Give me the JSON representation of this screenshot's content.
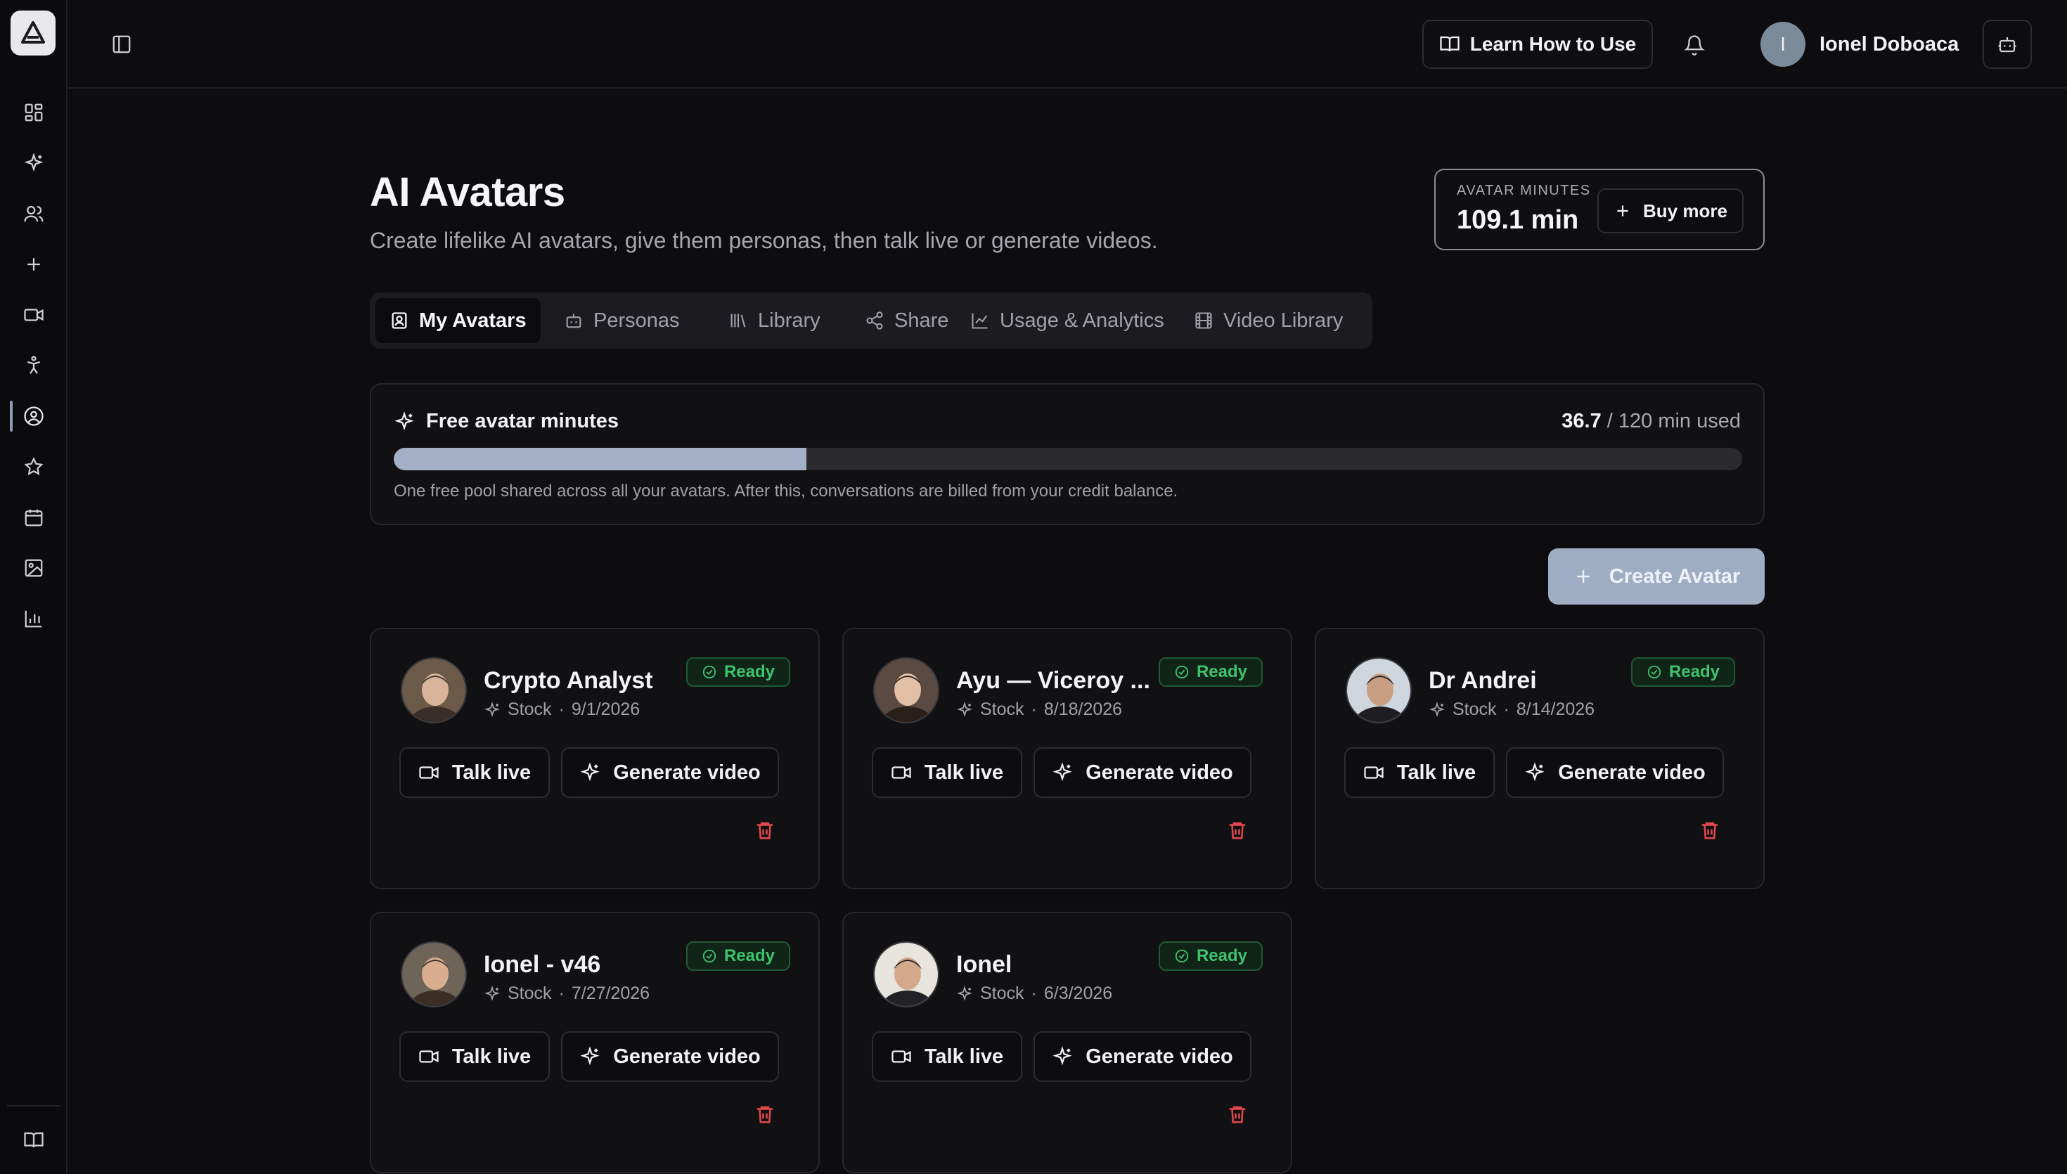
{
  "app": {
    "user_initial": "I",
    "user_name": "Ionel Doboaca",
    "learn_label": "Learn How to Use"
  },
  "header": {
    "title": "AI Avatars",
    "subtitle": "Create lifelike AI avatars, give them personas, then talk live or generate videos.",
    "minutes_label": "AVATAR MINUTES",
    "minutes_value": "109.1 min",
    "buy_label": "Buy more"
  },
  "tabs": [
    {
      "label": "My Avatars",
      "icon": "contact-icon",
      "active": true
    },
    {
      "label": "Personas",
      "icon": "bot-icon"
    },
    {
      "label": "Library",
      "icon": "library-icon"
    },
    {
      "label": "Share",
      "icon": "share-icon"
    },
    {
      "label": "Usage & Analytics",
      "icon": "chart-line-icon"
    },
    {
      "label": "Video Library",
      "icon": "film-icon"
    }
  ],
  "free_minutes": {
    "title": "Free avatar minutes",
    "used": "36.7",
    "total_text": "/ 120 min used",
    "used_fraction": 0.306,
    "note": "One free pool shared across all your avatars. After this, conversations are billed from your credit balance."
  },
  "create_label": "Create Avatar",
  "card_labels": {
    "ready": "Ready",
    "talk": "Talk live",
    "generate": "Generate video",
    "sep": "·"
  },
  "avatars": [
    {
      "name": "Crypto Analyst",
      "source": "Stock",
      "date": "9/1/2026"
    },
    {
      "name": "Ayu — Viceroy ...",
      "source": "Stock",
      "date": "8/18/2026"
    },
    {
      "name": "Dr Andrei",
      "source": "Stock",
      "date": "8/14/2026"
    },
    {
      "name": "Ionel - v46",
      "source": "Stock",
      "date": "7/27/2026"
    },
    {
      "name": "Ionel",
      "source": "Stock",
      "date": "6/3/2026"
    }
  ],
  "colors": {
    "accent": "#9fadc4",
    "ready": "#3fc16e",
    "danger": "#e5484d"
  }
}
